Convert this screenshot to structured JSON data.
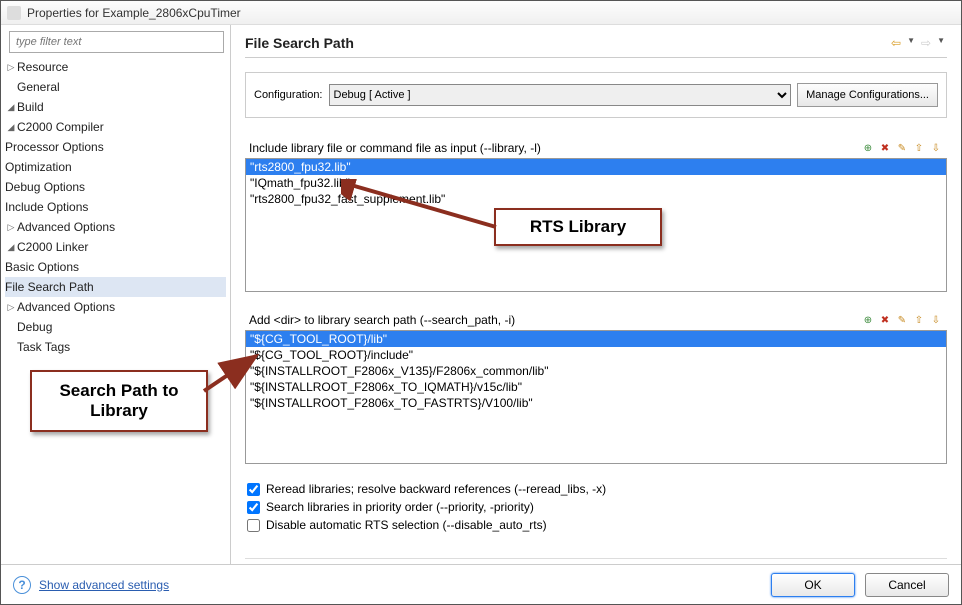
{
  "window": {
    "title": "Properties for Example_2806xCpuTimer"
  },
  "filter": {
    "placeholder": "type filter text"
  },
  "tree": {
    "resource": "Resource",
    "general": "General",
    "build": "Build",
    "c2000_compiler": "C2000 Compiler",
    "processor_options": "Processor Options",
    "optimization": "Optimization",
    "debug_options": "Debug Options",
    "include_options": "Include Options",
    "advanced_options_compiler": "Advanced Options",
    "c2000_linker": "C2000 Linker",
    "basic_options": "Basic Options",
    "file_search_path": "File Search Path",
    "advanced_options_linker": "Advanced Options",
    "debug": "Debug",
    "task_tags": "Task Tags"
  },
  "page": {
    "heading": "File Search Path",
    "config_label": "Configuration:",
    "config_options": [
      "Debug  [ Active ]"
    ],
    "manage_btn": "Manage Configurations...",
    "libraries_label": "Include library file or command file as input (--library, -l)",
    "library_items": [
      "\"rts2800_fpu32.lib\"",
      "\"IQmath_fpu32.lib\"",
      "\"rts2800_fpu32_fast_supplement.lib\""
    ],
    "search_path_label": "Add <dir> to library search path (--search_path, -i)",
    "search_path_items": [
      "\"${CG_TOOL_ROOT}/lib\"",
      "\"${CG_TOOL_ROOT}/include\"",
      "\"${INSTALLROOT_F2806x_V135}/F2806x_common/lib\"",
      "\"${INSTALLROOT_F2806x_TO_IQMATH}/v15c/lib\"",
      "\"${INSTALLROOT_F2806x_TO_FASTRTS}/V100/lib\""
    ],
    "cb1_label": "Reread libraries; resolve backward references (--reread_libs, -x)",
    "cb2_label": "Search libraries in priority order (--priority, -priority)",
    "cb3_label": "Disable automatic RTS selection (--disable_auto_rts)"
  },
  "footer": {
    "advanced_link": "Show advanced settings",
    "ok": "OK",
    "cancel": "Cancel"
  },
  "annotations": {
    "rts_library": "RTS Library",
    "search_path": "Search Path to Library"
  },
  "colors": {
    "accent": "#2d7fef",
    "callout_border": "#8b2e1f"
  }
}
